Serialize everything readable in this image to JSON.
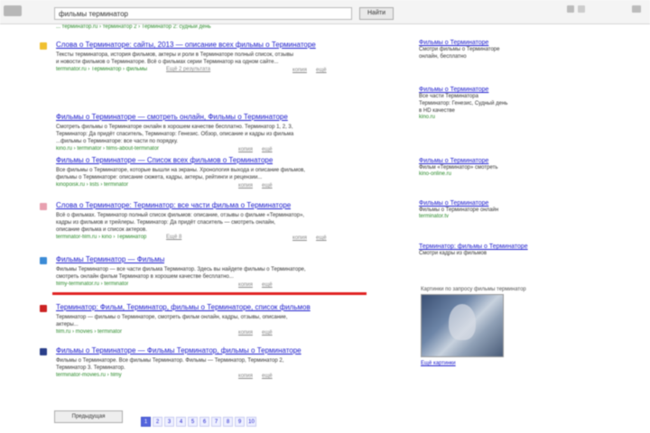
{
  "search": {
    "query": "фильмы терминатор",
    "button": "Найти"
  },
  "prev_url": "... терминатор.ru › терминатор 2 › Терминатор 2: судный день",
  "results": [
    {
      "title": "Слова о Терминаторе: сайты, 2013 — описание всех фильмы о Терминаторе",
      "snippet": [
        "Тексты терминатора, история фильмов, актеры и роли в Терминаторе полный список, отзывы",
        "и новости фильмов о Терминаторе. Всё о фильмах серии Терминатор на одном сайте..."
      ],
      "url": "terminator.ru › Терминатор › фильмы",
      "extra": "Ещё 2 результата",
      "acts": [
        "копия",
        "ещё"
      ],
      "fav_color": "#f0c030"
    },
    {
      "title": "Фильмы о Терминаторе — смотреть онлайн, Фильмы о Терминаторе",
      "snippet": [
        "Смотреть фильмы о Терминаторе онлайн в хорошем качестве бесплатно. Терминатор 1, 2, 3,",
        "Терминатор: Да придёт спаситель, Терминатор: Генезис. Обзор, описание и кадры из фильма",
        "...фильмы о Терминаторе: все части по порядку."
      ],
      "url": "kino.ru › terminator › films-about-terminator",
      "acts": [
        "копия",
        "ещё"
      ],
      "fav_color": ""
    },
    {
      "title": "Фильмы о Терминаторе — Список всех фильмов о Терминаторе",
      "snippet": [
        "Все фильмы о Терминаторе, которые вышли на экраны. Хронология выхода и описание фильмов,",
        "фильмы о Терминаторе: описание сюжета, кадры, актеры, рейтинги и рецензии..."
      ],
      "url": "kinopoisk.ru › lists › terminator",
      "acts": [
        "копия",
        "ещё"
      ],
      "fav_color": ""
    },
    {
      "title": "Слова о Терминаторе: Терминатор: все части фильма о Терминаторе",
      "snippet": [
        "Всё о фильмах. Терминатор полный список фильмов: описание, отзывы о фильме «Терминатор»,",
        "кадры из фильмов и трейлеры. Терминатор: Да придёт спаситель — смотреть онлайн,",
        "описание фильма и список актеров."
      ],
      "url": "terminator-film.ru › kino › Терминатор",
      "extra": "Ещё 8",
      "acts": [
        "копия",
        "ещё"
      ],
      "fav_color": "#e8a0b0"
    },
    {
      "title": "Фильмы Терминатор — Фильмы",
      "snippet": [
        "Фильмы Терминатор — все части фильма Терминатор. Здесь вы найдете фильмы о Терминаторе,",
        "смотреть онлайн фильм Терминатор в хорошем качестве бесплатно..."
      ],
      "url": "filmy-terminator.ru › terminator",
      "acts": [
        "копия",
        "ещё"
      ],
      "fav_color": "#3b8bd6"
    },
    {
      "title": "Терминатор: Фильм, Терминатор, фильмы о Терминаторе, список фильмов",
      "snippet": [
        "Терминатор — фильмы о Терминаторе, смотреть фильм онлайн, кадры, отзывы, описание,",
        "актеры..."
      ],
      "url": "film.ru › movies › terminator",
      "acts": [
        "копия",
        "ещё"
      ],
      "fav_color": "#cc2222"
    },
    {
      "title": "Фильмы о Терминаторе — Фильмы Терминатор, фильмы о Терминаторе",
      "snippet": [
        "Фильмы о Терминаторе. Все фильмы Терминатор. Фильмы — Терминатор, Терминатор 2,",
        "Терминатор 3. Терминатор."
      ],
      "url": "terminator-movies.ru › filmy",
      "acts": [
        "копия",
        "ещё"
      ],
      "fav_color": "#2a3f8a"
    }
  ],
  "pager": {
    "prev": "Предыдущая",
    "pages": [
      "1",
      "2",
      "3",
      "4",
      "5",
      "6",
      "7",
      "8",
      "9",
      "10"
    ],
    "current": "1"
  },
  "ads": [
    {
      "title": "Фильмы о Терминаторе",
      "lines": [
        "Смотри фильмы о Терминаторе",
        "онлайн, бесплатно"
      ],
      "url": ""
    },
    {
      "title": "Фильмы о Терминаторе",
      "lines": [
        "Все части Терминатора",
        "Терминатор: Генезис, Судный день",
        "в HD качестве"
      ],
      "url": "kino.ru"
    },
    {
      "title": "Фильмы о Терминаторе",
      "lines": [
        "Фильм «Терминатор» смотреть"
      ],
      "url": "kino-online.ru"
    },
    {
      "title": "Фильмы о Терминаторе",
      "lines": [
        "Фильмы о Терминаторе онлайн"
      ],
      "url": "terminator.tv"
    },
    {
      "title": "Терминатор: фильмы о Терминаторе",
      "lines": [
        "Смотри кадры из фильмов"
      ],
      "url": ""
    }
  ],
  "images": {
    "heading": "Картинки по запросу фильмы терминатор",
    "more": "Ещё картинки"
  }
}
